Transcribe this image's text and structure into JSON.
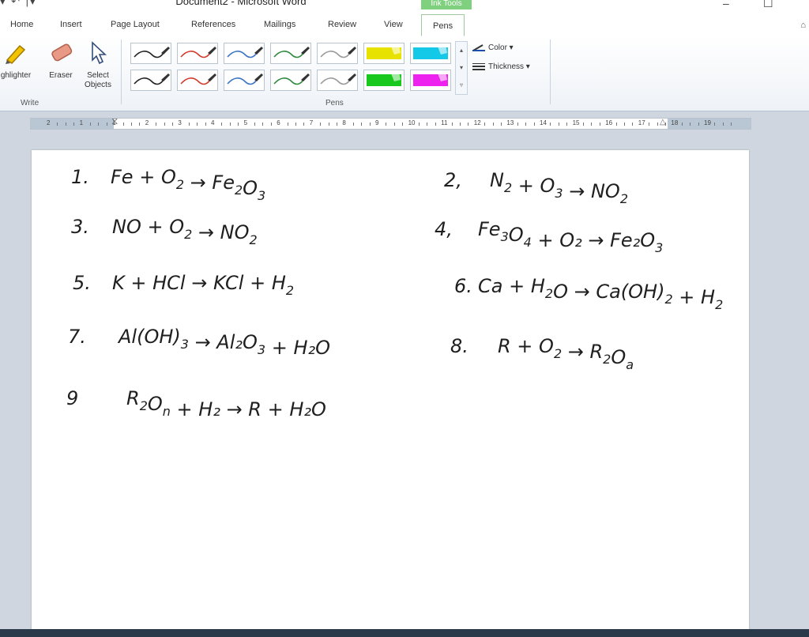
{
  "window": {
    "title": "Document2 - Microsoft Word",
    "contextual_tab": "Ink Tools",
    "controls": [
      "–",
      "☐"
    ]
  },
  "tabs": [
    {
      "label": "Home"
    },
    {
      "label": "Insert"
    },
    {
      "label": "Page Layout"
    },
    {
      "label": "References"
    },
    {
      "label": "Mailings"
    },
    {
      "label": "Review"
    },
    {
      "label": "View"
    },
    {
      "label": "Pens"
    }
  ],
  "active_tab": "Pens",
  "ribbon": {
    "write_group": {
      "label": "Write",
      "buttons": [
        {
          "label": "ghlighter",
          "icon": "highlighter-icon"
        },
        {
          "label": "Eraser",
          "icon": "eraser-icon"
        },
        {
          "label": "Select Objects",
          "icon": "select-arrow-icon"
        }
      ]
    },
    "pens_group": {
      "label": "Pens",
      "pen_colors": [
        "#222222",
        "#d23b2b",
        "#3b74c4",
        "#2f8a3f",
        "#9a9a9a",
        "#e8e200",
        "#14c8e8",
        "#222222",
        "#d23b2b",
        "#3b74c4",
        "#2f8a3f",
        "#9a9a9a",
        "#18c81c",
        "#ee22ee"
      ],
      "color_label": "Color ▾",
      "thickness_label": "Thickness ▾"
    }
  },
  "ruler": {
    "numbers": [
      "2",
      "1",
      "1",
      "2",
      "3",
      "4",
      "5",
      "6",
      "7",
      "8",
      "9",
      "10",
      "11",
      "12",
      "13",
      "14",
      "15",
      "16",
      "17",
      "18",
      "19"
    ]
  },
  "document": {
    "equations": [
      {
        "num": "1.",
        "text": "Fe + O",
        "sub": "2",
        "rest": " → Fe",
        "rest_sub": "2",
        "tail": "O",
        "tail_sub": "3"
      },
      {
        "num": "2,",
        "text": "N",
        "sub": "2",
        "rest": " + O",
        "rest_sub": "3",
        "tail": " → NO",
        "tail_sub": "2"
      },
      {
        "num": "3.",
        "text": "NO + O",
        "sub": "2",
        "rest": " → NO",
        "rest_sub": "2",
        "tail": "",
        "tail_sub": ""
      },
      {
        "num": "4,",
        "text": "Fe",
        "sub": "3",
        "rest": "O",
        "rest_sub": "4",
        "tail": " + O₂ → Fe₂O",
        "tail_sub": "3"
      },
      {
        "num": "5.",
        "text": "K + HCl → KCl + H",
        "sub": "2",
        "rest": "",
        "rest_sub": "",
        "tail": "",
        "tail_sub": ""
      },
      {
        "num": "6.",
        "text": "Ca + H",
        "sub": "2",
        "rest": "O → Ca(OH)",
        "rest_sub": "2",
        "tail": " + H",
        "tail_sub": "2"
      },
      {
        "num": "7.",
        "text": "Al(OH)",
        "sub": "3",
        "rest": " → Al₂O",
        "rest_sub": "3",
        "tail": " + H₂O",
        "tail_sub": ""
      },
      {
        "num": "8.",
        "text": "R + O",
        "sub": "2",
        "rest": " → R",
        "rest_sub": "2",
        "tail": "O",
        "tail_sub": "a"
      },
      {
        "num": "9",
        "text": "R",
        "sub": "2",
        "rest": "O",
        "rest_sub": "n",
        "tail": " + H₂ → R + H₂O",
        "tail_sub": ""
      }
    ]
  }
}
